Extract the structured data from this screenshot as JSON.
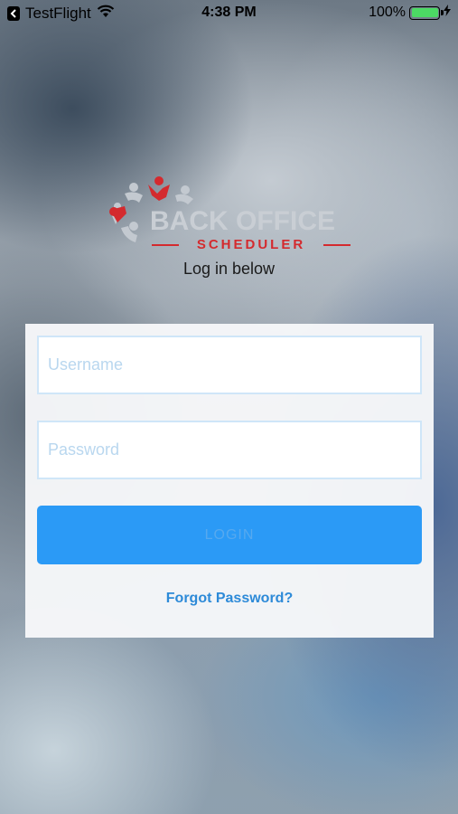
{
  "status_bar": {
    "back_app": "TestFlight",
    "time": "4:38 PM",
    "battery_percent": "100%"
  },
  "logo": {
    "title": "BACK OFFICE",
    "subtitle": "SCHEDULER"
  },
  "login": {
    "tagline": "Log in below",
    "username_placeholder": "Username",
    "password_placeholder": "Password",
    "login_label": "LOGIN",
    "forgot_label": "Forgot Password?"
  },
  "colors": {
    "brand_red": "#d42a2e",
    "button_blue": "#2b9af6",
    "link_blue": "#2d8ad8"
  }
}
